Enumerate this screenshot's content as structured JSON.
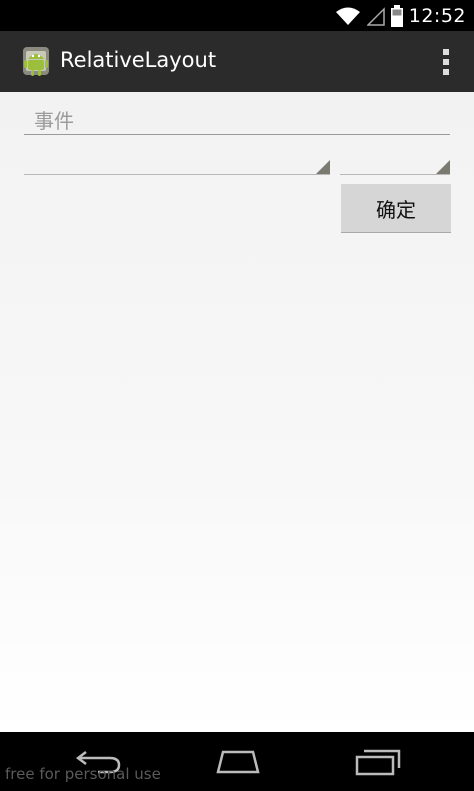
{
  "status_bar": {
    "time": "12:52",
    "icons": [
      "wifi-icon",
      "signal-icon",
      "battery-icon"
    ]
  },
  "action_bar": {
    "title": "RelativeLayout",
    "icon": "android-app-icon",
    "overflow_icon": "overflow-menu-icon"
  },
  "form": {
    "event_hint": "事件",
    "spinner_1_value": "",
    "spinner_2_value": "",
    "confirm_label": "确定"
  },
  "nav_bar": {
    "icons": [
      "back-icon",
      "home-icon",
      "recents-icon"
    ],
    "watermark": "free for personal use"
  },
  "colors": {
    "action_bar": "#2b2b2b",
    "content_bg": "#f5f5f5",
    "button_bg": "#d6d6d6"
  }
}
